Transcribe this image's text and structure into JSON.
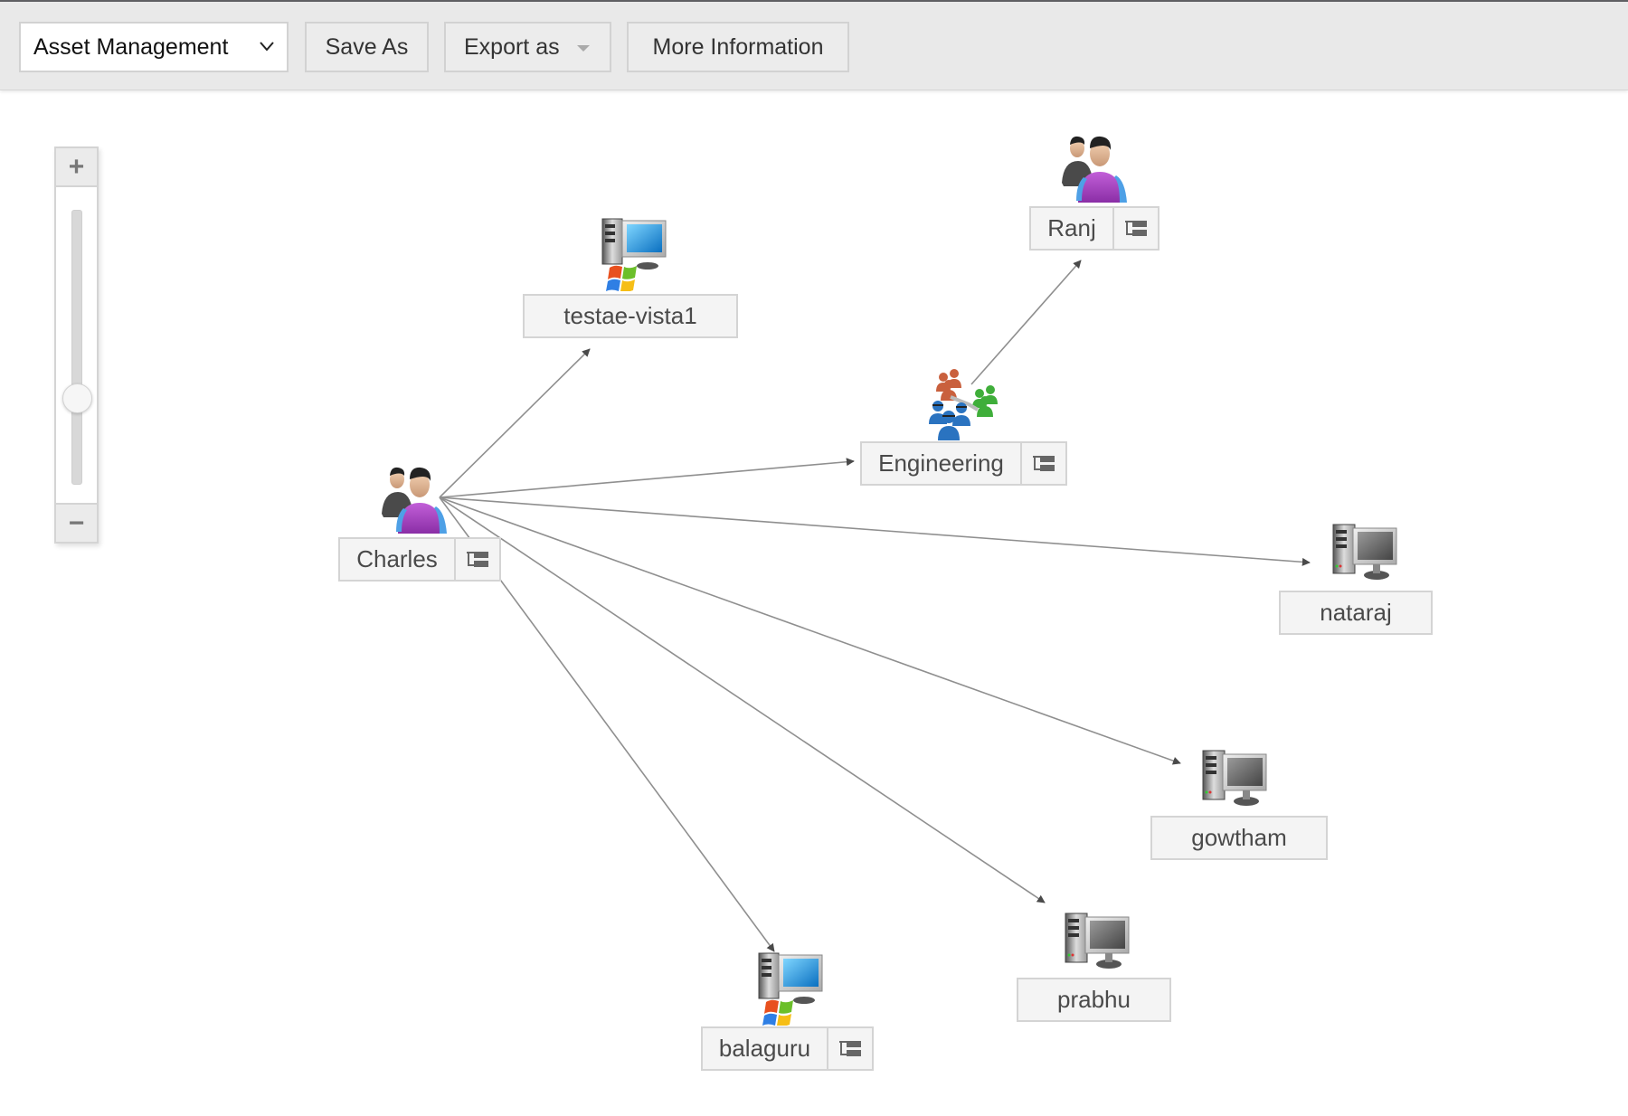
{
  "toolbar": {
    "view_select": {
      "value": "Asset Management",
      "icon": "chevron-down-icon"
    },
    "save_as_label": "Save As",
    "export_label": "Export as",
    "export_icon": "caret-down-icon",
    "more_info_label": "More Information"
  },
  "zoom_control": {
    "plus_label": "+",
    "minus_label": "−",
    "level": 0.32
  },
  "graph": {
    "nodes": [
      {
        "id": "charles",
        "label": "Charles",
        "type": "user",
        "icon": "user-icon",
        "has_tree": true
      },
      {
        "id": "testae",
        "label": "testae-vista1",
        "type": "windows-workstation",
        "icon": "windows-computer-icon",
        "has_tree": false
      },
      {
        "id": "engineering",
        "label": "Engineering",
        "type": "department",
        "icon": "department-group-icon",
        "has_tree": true
      },
      {
        "id": "ranj",
        "label": "Ranj",
        "type": "user",
        "icon": "user-icon",
        "has_tree": true
      },
      {
        "id": "nataraj",
        "label": "nataraj",
        "type": "workstation",
        "icon": "computer-icon",
        "has_tree": false
      },
      {
        "id": "gowtham",
        "label": "gowtham",
        "type": "workstation",
        "icon": "computer-icon",
        "has_tree": false
      },
      {
        "id": "prabhu",
        "label": "prabhu",
        "type": "workstation",
        "icon": "computer-icon",
        "has_tree": false
      },
      {
        "id": "balaguru",
        "label": "balaguru",
        "type": "windows-workstation",
        "icon": "windows-computer-icon",
        "has_tree": true
      }
    ],
    "edges": [
      {
        "from": "charles",
        "to": "testae"
      },
      {
        "from": "charles",
        "to": "engineering"
      },
      {
        "from": "charles",
        "to": "nataraj"
      },
      {
        "from": "charles",
        "to": "gowtham"
      },
      {
        "from": "charles",
        "to": "prabhu"
      },
      {
        "from": "charles",
        "to": "balaguru"
      },
      {
        "from": "engineering",
        "to": "ranj"
      }
    ],
    "tree_icon": "hierarchy-tree-icon"
  }
}
